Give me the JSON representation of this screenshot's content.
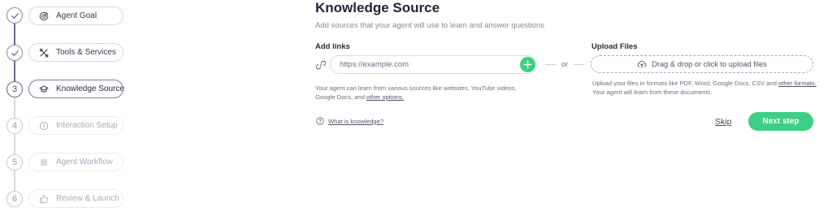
{
  "stepper": {
    "steps": [
      {
        "number": "1",
        "label": "Agent Goal",
        "state": "done",
        "icon": "target-icon"
      },
      {
        "number": "2",
        "label": "Tools & Services",
        "state": "done",
        "icon": "tools-icon"
      },
      {
        "number": "3",
        "label": "Knowledge Source",
        "state": "active",
        "icon": "graduation-cap-icon"
      },
      {
        "number": "4",
        "label": "Interaction Setup",
        "state": "todo",
        "icon": "interaction-icon"
      },
      {
        "number": "5",
        "label": "Agent Workflow",
        "state": "todo",
        "icon": "list-icon"
      },
      {
        "number": "6",
        "label": "Review & Launch",
        "state": "todo",
        "icon": "thumbs-up-icon"
      }
    ]
  },
  "main": {
    "title": "Knowledge Source",
    "subtitle": "Add sources that your agent will use to learn and answer questions"
  },
  "links": {
    "label": "Add links",
    "placeholder": "https://example.com",
    "value": "",
    "help_prefix": "Your agent can learn from various sources like websites, YouTube videos, Google Docs, and ",
    "help_link": "other options."
  },
  "separator": {
    "or_text": "or"
  },
  "upload": {
    "label": "Upload Files",
    "dropzone_text": "Drag & drop or click to upload files",
    "help_prefix": "Upload your files in formats like PDF, Word, Google Docs, CSV and ",
    "help_link": "other formats.",
    "help_suffix": "Your agent will learn from these documents."
  },
  "footer": {
    "knowledge_link": "What is knowledge?",
    "skip_label": "Skip",
    "next_label": "Next step"
  },
  "colors": {
    "accent_green": "#3ccf85",
    "stepper_line_done": "#6c6890",
    "stepper_line_todo": "#d9d8e3"
  }
}
